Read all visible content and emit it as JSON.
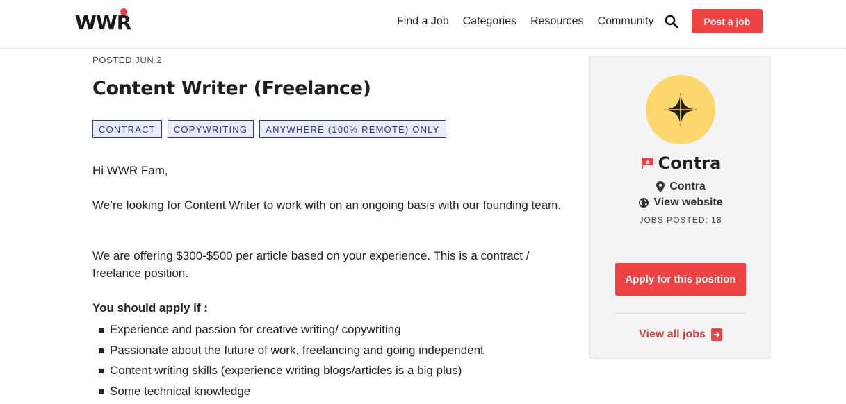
{
  "header": {
    "logo": "WWR",
    "nav": [
      "Find a Job",
      "Categories",
      "Resources",
      "Community"
    ],
    "post_job_label": "Post a job"
  },
  "job": {
    "posted": "POSTED JUN 2",
    "title": "Content Writer (Freelance)",
    "tags": [
      "CONTRACT",
      "COPYWRITING",
      "ANYWHERE (100% REMOTE) ONLY"
    ],
    "greeting": "Hi WWR Fam,",
    "para1": "We’re looking for Content Writer to work with on an ongoing basis with our founding team.",
    "para2": "We are offering $300-$500 per article based on your experience. This is a contract / freelance position.",
    "apply_heading": "You should apply if :",
    "requirements": [
      "Experience and passion for creative writing/ copywriting",
      "Passionate about the future of work, freelancing and going independent",
      "Content writing skills (experience writing blogs/articles is a big plus)",
      "Some technical knowledge"
    ]
  },
  "company": {
    "name": "Contra",
    "location": "Contra",
    "website_label": "View website",
    "jobs_posted": "JOBS POSTED: 18",
    "apply_label": "Apply for this position",
    "view_all_label": "View all jobs",
    "logo_bg": "#fcd76b"
  },
  "colors": {
    "accent": "#ef4242",
    "tag_border": "#2e3a8c",
    "tag_bg": "#e8ecff"
  }
}
